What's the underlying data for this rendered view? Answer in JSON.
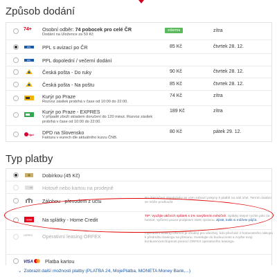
{
  "shipping": {
    "title": "Způsob dodání",
    "options": [
      {
        "logo": "74+",
        "label_prefix": "Osobní odběr: ",
        "label_bold": "74 pobocek pro celé ČR",
        "sub": "Dodání na Uložence za 59 Kč",
        "badge": "zdarma",
        "date": "zítra",
        "checked": false
      },
      {
        "logo": "PPL",
        "label": "PPL s avizací po ČR",
        "price": "85 Kč",
        "date": "čtvrtek 28. 12.",
        "checked": true
      },
      {
        "logo": "PPL",
        "label": "PPL dopolední / večerní dodání",
        "checked": false
      },
      {
        "logo": "Česká pošta",
        "label": "Česká pošta - Do ruky",
        "price": "90 Kč",
        "date": "čtvrtek 28. 12.",
        "checked": false
      },
      {
        "logo": "Česká pošta",
        "label": "Česká pošta - Na poštu",
        "price": "85 Kč",
        "date": "čtvrtek 28. 12.",
        "checked": false
      },
      {
        "logo": "courier",
        "label": "Kurýr po Praze",
        "sub": "Rozvoz zásilek probíhá v čase od 10:00 do 22:00.",
        "price": "74 Kč",
        "date": "zítra",
        "checked": false
      },
      {
        "logo": "courier-express",
        "label": "Kurýr po Praze - EXPRES",
        "sub": "V případě zboží skladem doručení do 120 minut. Rozvoz zásilek probíhá v čase od 10:00 do 22:00.",
        "price": "189 Kč",
        "date": "zítra",
        "checked": false
      },
      {
        "logo": "DPD",
        "label": "DPD na Slovensko",
        "sub": "Faktura v eurech dle aktuálního kurzu ČNB.",
        "price": "80 Kč",
        "date": "pátek 29. 12.",
        "checked": false
      }
    ]
  },
  "payment": {
    "title": "Typ platby",
    "options": [
      {
        "label": "Dobírkou (45 Kč)",
        "checked": true,
        "disabled": false
      },
      {
        "label": "Hotově nebo kartou na prodejně",
        "checked": false,
        "disabled": true
      },
      {
        "label": "Zálohou - převodem z účtu",
        "checked": false,
        "disabled": false,
        "note": "Po dokončení objednávky se vám zobrazí pokyny k platbě na náš účet. Termín dodání se může prodloužit."
      },
      {
        "label": "Na splátky - Home Credit",
        "checked": false,
        "disabled": false,
        "note_red": "TIP: Využijte akčních splátek s 1% navýšením měsíčně.",
        "note": "Splátky stejné rychle jako za hotové, vyřízení pouze podpisem SMS zprávou.",
        "note_link": "Zjistit, kolik si můžete půjčit."
      },
      {
        "label": "Operativní leasing ORFEX",
        "checked": false,
        "disabled": true,
        "note": "Operativní leasing ORFEX je vhodný pro všechny, kdo přechází z hotovostního nákupu k předmětu leasingu na přesunu. Investujte do budoucnosti a zvyšte svoji konkurenceschopnost pomocí ORFEX operativního leasingu."
      },
      {
        "label": "Platba kartou",
        "checked": false,
        "disabled": false
      }
    ],
    "more_link": "Zobrazit další možnosti platby (PLATBA 24, MojePlatba, MONETA Money Bank,...)"
  },
  "colors": {
    "accent": "#5cb85c",
    "link": "#1a57a5",
    "red": "#d0021b"
  }
}
